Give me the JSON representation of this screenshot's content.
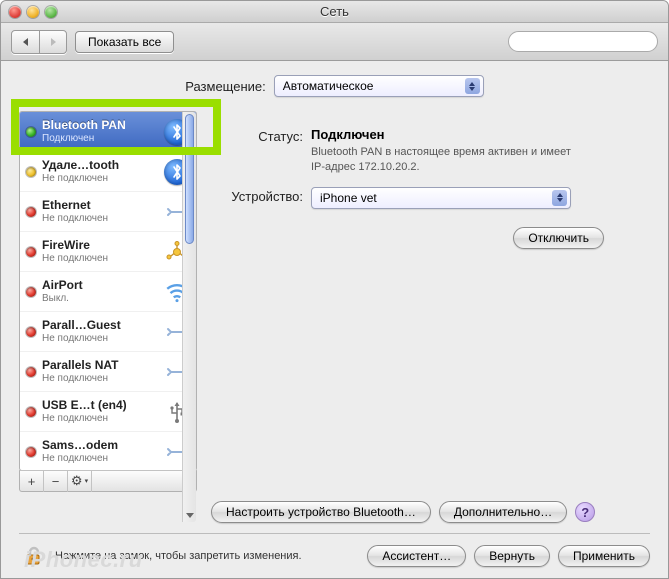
{
  "window": {
    "title": "Сеть"
  },
  "toolbar": {
    "show_all": "Показать все",
    "search_placeholder": ""
  },
  "location": {
    "label": "Размещение:",
    "value": "Автоматическое"
  },
  "sidebar": {
    "items": [
      {
        "name": "Bluetooth PAN",
        "sub": "Подключен",
        "status": "green",
        "icon": "bluetooth",
        "selected": true
      },
      {
        "name": "Удале…tooth",
        "sub": "Не подключен",
        "status": "yellow",
        "icon": "bluetooth"
      },
      {
        "name": "Ethernet",
        "sub": "Не подключен",
        "status": "red",
        "icon": "ethernet"
      },
      {
        "name": "FireWire",
        "sub": "Не подключен",
        "status": "red",
        "icon": "firewire"
      },
      {
        "name": "AirPort",
        "sub": "Выкл.",
        "status": "red",
        "icon": "wifi"
      },
      {
        "name": "Parall…Guest",
        "sub": "Не подключен",
        "status": "red",
        "icon": "ethernet"
      },
      {
        "name": "Parallels NAT",
        "sub": "Не подключен",
        "status": "red",
        "icon": "ethernet"
      },
      {
        "name": "USB E…t (en4)",
        "sub": "Не подключен",
        "status": "red",
        "icon": "usb"
      },
      {
        "name": "Sams…odem",
        "sub": "Не подключен",
        "status": "red",
        "icon": "ethernet"
      }
    ],
    "footer": {
      "add": "+",
      "remove": "−",
      "gear": "⚙"
    }
  },
  "detail": {
    "status_label": "Статус:",
    "status_value": "Подключен",
    "status_desc": "Bluetooth PAN в настоящее время активен и имеет IP-адрес 172.10.20.2.",
    "device_label": "Устройство:",
    "device_value": "iPhone vet",
    "disconnect": "Отключить",
    "configure_bt": "Настроить устройство Bluetooth…",
    "advanced": "Дополнительно…",
    "help": "?"
  },
  "footer": {
    "lock_text": "Нажмите на замок, чтобы запретить изменения.",
    "assistant": "Ассистент…",
    "revert": "Вернуть",
    "apply": "Применить"
  },
  "watermark": "iPhonec.ru"
}
